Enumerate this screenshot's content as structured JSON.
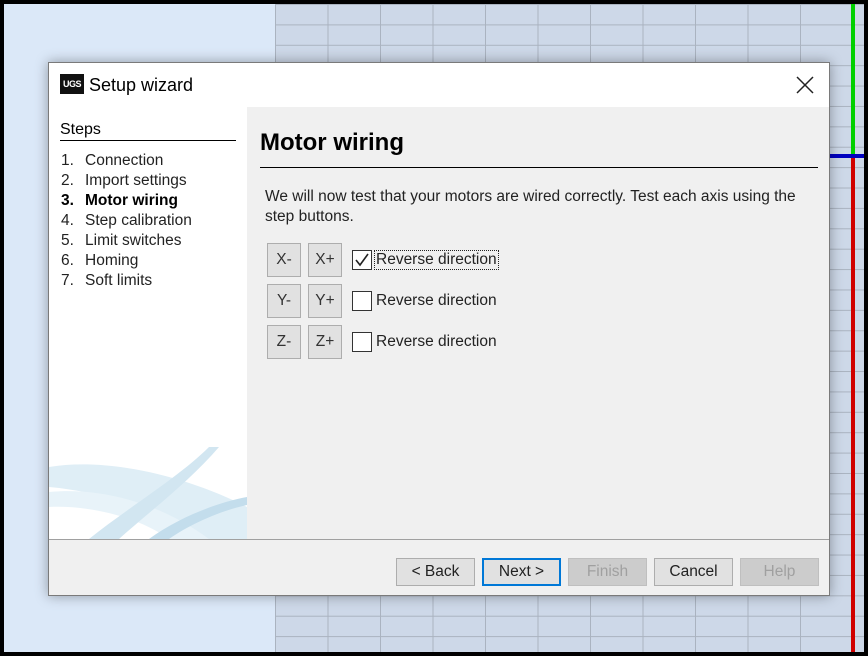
{
  "dialog": {
    "logo_text": "UGS",
    "title": "Setup wizard"
  },
  "sidebar": {
    "heading": "Steps",
    "steps": [
      {
        "num": "1.",
        "label": "Connection"
      },
      {
        "num": "2.",
        "label": "Import settings"
      },
      {
        "num": "3.",
        "label": "Motor wiring"
      },
      {
        "num": "4.",
        "label": "Step calibration"
      },
      {
        "num": "5.",
        "label": "Limit switches"
      },
      {
        "num": "6.",
        "label": "Homing"
      },
      {
        "num": "7.",
        "label": "Soft limits"
      }
    ],
    "active_step": 2
  },
  "content": {
    "title": "Motor wiring",
    "intro": "We will now test that your motors are wired correctly. Test each axis using the step buttons.",
    "axes": [
      {
        "minus": "X-",
        "plus": "X+",
        "reverse_label": "Reverse direction",
        "checked": true
      },
      {
        "minus": "Y-",
        "plus": "Y+",
        "reverse_label": "Reverse direction",
        "checked": false
      },
      {
        "minus": "Z-",
        "plus": "Z+",
        "reverse_label": "Reverse direction",
        "checked": false
      }
    ]
  },
  "footer": {
    "back": "< Back",
    "next": "Next >",
    "finish": "Finish",
    "cancel": "Cancel",
    "help": "Help"
  },
  "colors": {
    "accent": "#0078d7",
    "axis_green": "#00d000",
    "axis_red": "#d00000",
    "axis_blue": "#0000c0"
  }
}
